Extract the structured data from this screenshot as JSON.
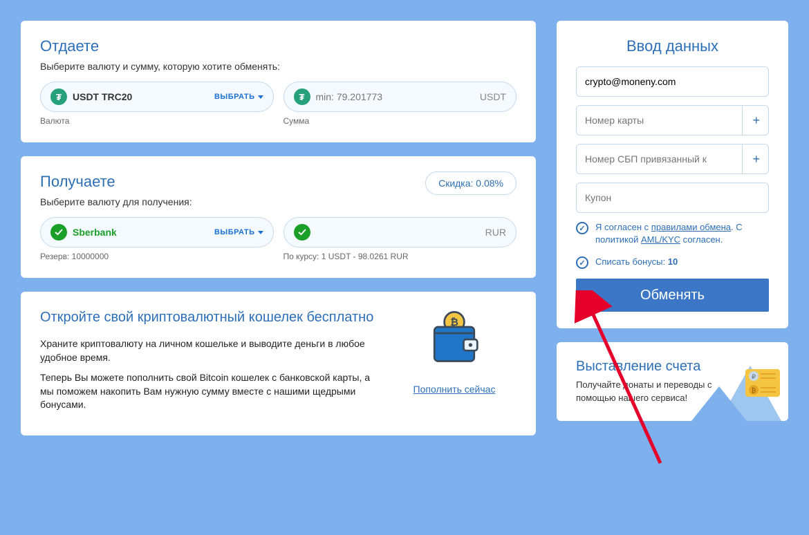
{
  "give": {
    "title": "Отдаете",
    "subtitle": "Выберите валюту и сумму, которую хотите обменять:",
    "currency_name": "USDT TRC20",
    "select_label": "ВЫБРАТЬ",
    "amount_placeholder": "min: 79.201773",
    "ticker": "USDT",
    "currency_label": "Валюта",
    "amount_label": "Сумма"
  },
  "receive": {
    "title": "Получаете",
    "subtitle": "Выберите валюту для получения:",
    "discount": "Скидка: 0.08%",
    "currency_name": "Sberbank",
    "select_label": "ВЫБРАТЬ",
    "ticker": "RUR",
    "reserve_label": "Резерв: 10000000",
    "rate_label": "По курсу: 1 USDT - 98.0261 RUR"
  },
  "wallet": {
    "title": "Откройте свой криптовалютный кошелек бесплатно",
    "p1": "Храните криптовалюту на личном кошельке и выводите деньги в любое удобное время.",
    "p2": "Теперь Вы можете пополнить свой Bitcoin кошелек с банковской карты, а мы поможем накопить Вам нужную сумму вместе с нашими щедрыми бонусами.",
    "refill_label": "Пополнить сейчас"
  },
  "data_entry": {
    "title": "Ввод данных",
    "email_value": "crypto@moneny.com",
    "card_placeholder": "Номер карты",
    "sbp_placeholder": "Номер СБП привязанный к",
    "coupon_placeholder": "Купон",
    "agree_prefix": "Я согласен с ",
    "agree_rules": "правилами обмена",
    "agree_middle": ". С политикой ",
    "agree_aml": "AML/KYC",
    "agree_suffix": " согласен.",
    "bonus_label": "Списать бонусы: ",
    "bonus_value": "10",
    "submit_label": "Обменять"
  },
  "invoice": {
    "title": "Выставление счета",
    "subtitle": "Получайте донаты и переводы с помощью нашего сервиса!"
  }
}
